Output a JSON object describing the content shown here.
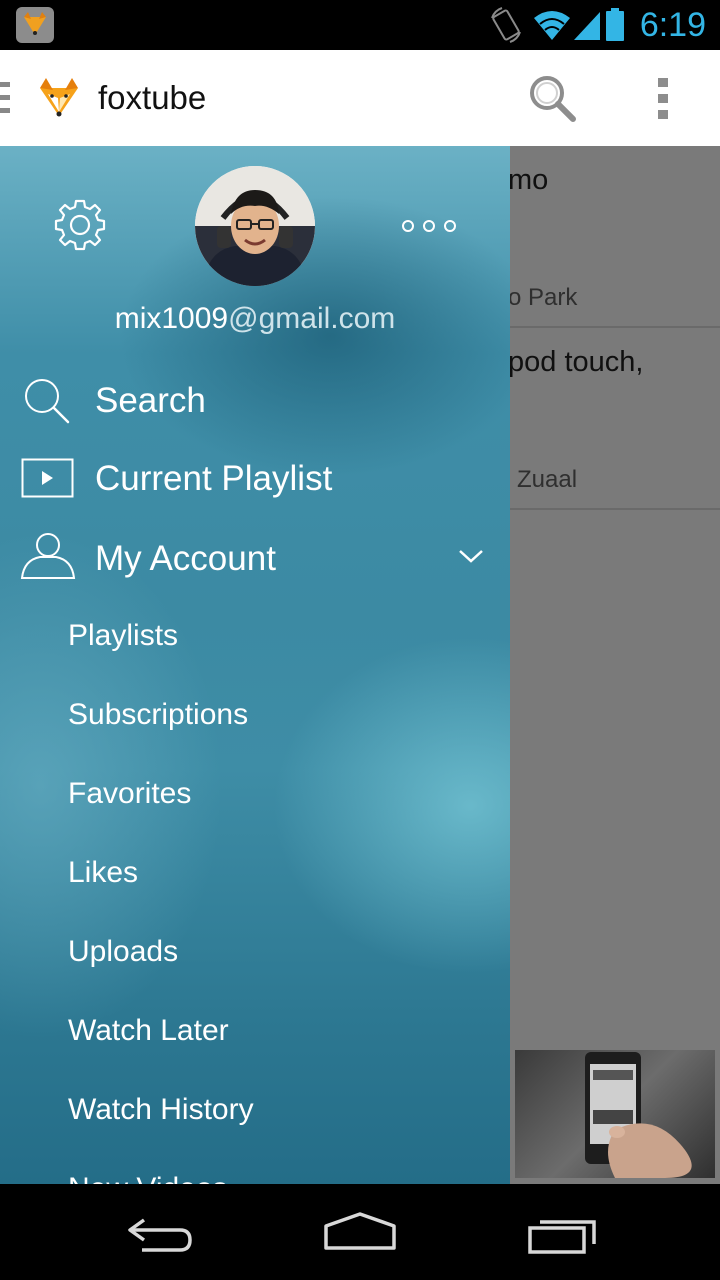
{
  "status_bar": {
    "time": "6:19",
    "icons": [
      "fox-app-icon",
      "rotate-icon",
      "wifi-icon",
      "signal-icon",
      "battery-icon"
    ],
    "accent_color": "#33b5e5"
  },
  "action_bar": {
    "app_name": "foxtube",
    "icons": [
      "drawer-toggle-icon",
      "fox-logo-icon",
      "search-icon",
      "overflow-menu-icon"
    ]
  },
  "background_list": {
    "items": [
      {
        "title_fragment": "mo",
        "subtitle_fragment": "o Park"
      },
      {
        "title_fragment": "pod touch,",
        "subtitle_fragment": "Zuaal"
      }
    ]
  },
  "drawer": {
    "email_user": "mix1009",
    "email_domain": "@gmail.com",
    "header_icons": [
      "settings-gear-icon",
      "avatar",
      "more-dots-icon"
    ],
    "menu": [
      {
        "label": "Search",
        "icon": "search-icon"
      },
      {
        "label": "Current Playlist",
        "icon": "playlist-play-icon"
      },
      {
        "label": "My Account",
        "icon": "person-icon",
        "expanded": true
      }
    ],
    "account_items": [
      "Playlists",
      "Subscriptions",
      "Favorites",
      "Likes",
      "Uploads",
      "Watch Later",
      "Watch History",
      "New Videos"
    ]
  },
  "nav_bar": {
    "buttons": [
      "back-icon",
      "home-icon",
      "recent-apps-icon"
    ]
  }
}
